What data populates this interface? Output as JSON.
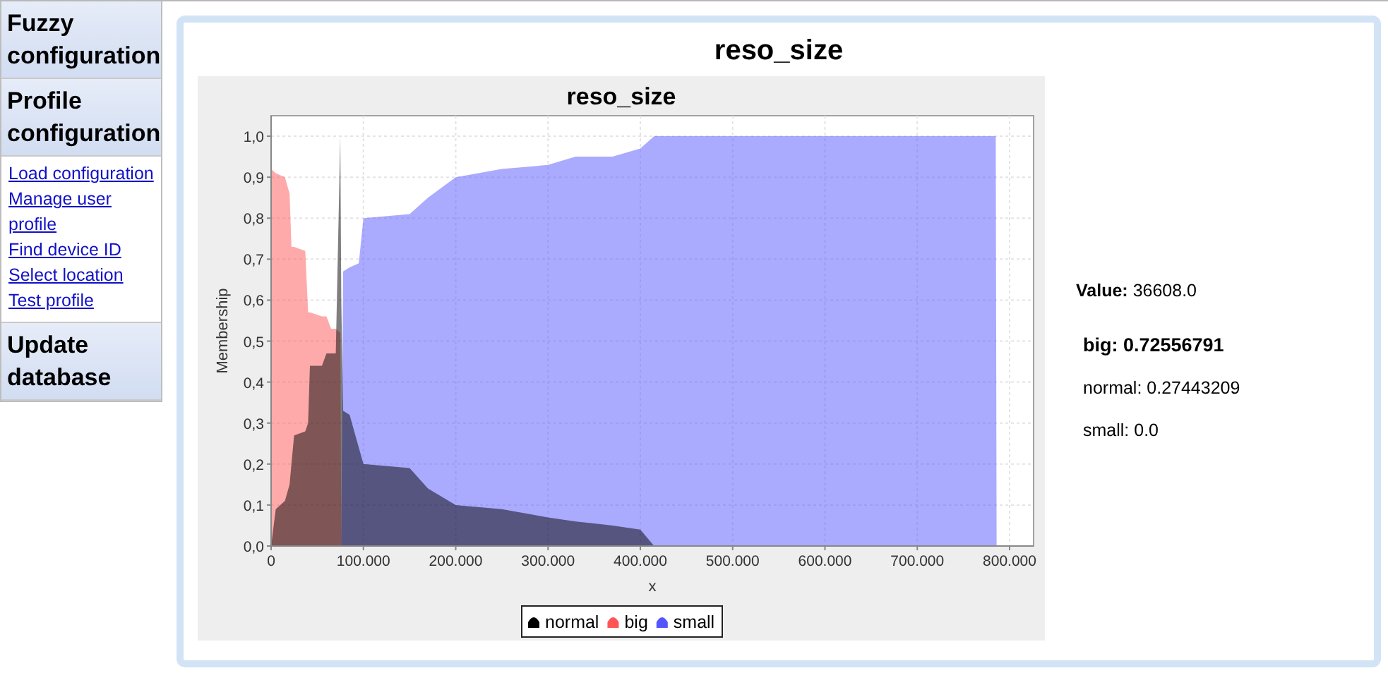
{
  "sidebar": [
    {
      "title": "Fuzzy configuration"
    },
    {
      "title": "Profile configuration",
      "links": [
        "Load configuration",
        "Manage user profile",
        "Find device ID",
        "Select location",
        "Test profile"
      ]
    },
    {
      "title": "Update database"
    }
  ],
  "panel_title": "reso_size",
  "chart_data": {
    "type": "area",
    "title": "reso_size",
    "xlabel": "x",
    "ylabel": "Membership",
    "x": [
      0,
      5000,
      15000,
      20000,
      22000,
      25000,
      37000,
      40000,
      42000,
      55000,
      60000,
      65000,
      70000,
      75000,
      76000,
      78000,
      85000,
      95000,
      100000,
      150000,
      170000,
      200000,
      250000,
      300000,
      330000,
      350000,
      370000,
      400000,
      415000,
      785000,
      786000
    ],
    "series": [
      {
        "name": "normal",
        "color": "#000000",
        "values": [
          0,
          0.09,
          0.11,
          0.15,
          0.2,
          0.27,
          0.28,
          0.3,
          0.44,
          0.44,
          0.47,
          0.47,
          0.47,
          1.0,
          0.6,
          0.33,
          0.32,
          0.24,
          0.2,
          0.19,
          0.14,
          0.1,
          0.09,
          0.07,
          0.06,
          0.055,
          0.05,
          0.04,
          0,
          null,
          null
        ]
      },
      {
        "name": "big",
        "color": "#ff5555",
        "values": [
          0.92,
          0.91,
          0.9,
          0.86,
          0.73,
          0.73,
          0.72,
          0.57,
          0.57,
          0.56,
          0.56,
          0.53,
          0.53,
          0.52,
          0,
          null,
          null,
          null,
          null,
          null,
          null,
          null,
          null,
          null,
          null,
          null,
          null,
          null,
          null,
          null,
          null
        ]
      },
      {
        "name": "small",
        "color": "#5555ff",
        "values": [
          null,
          null,
          null,
          null,
          null,
          null,
          null,
          null,
          null,
          null,
          null,
          null,
          null,
          null,
          0,
          0.67,
          0.68,
          0.69,
          0.8,
          0.81,
          0.85,
          0.9,
          0.92,
          0.93,
          0.95,
          0.95,
          0.95,
          0.97,
          1.0,
          1.0,
          0
        ]
      }
    ],
    "xlim": [
      0,
      826000
    ],
    "ylim": [
      0,
      1.05
    ],
    "grid": true,
    "legend": true,
    "xticks": [
      {
        "value": 0,
        "label": "0"
      },
      {
        "value": 100000,
        "label": "100.000"
      },
      {
        "value": 200000,
        "label": "200.000"
      },
      {
        "value": 300000,
        "label": "300.000"
      },
      {
        "value": 400000,
        "label": "400.000"
      },
      {
        "value": 500000,
        "label": "500.000"
      },
      {
        "value": 600000,
        "label": "600.000"
      },
      {
        "value": 700000,
        "label": "700.000"
      },
      {
        "value": 800000,
        "label": "800.000"
      }
    ],
    "yticks": [
      {
        "value": 0,
        "label": "0,0"
      },
      {
        "value": 0.1,
        "label": "0,1"
      },
      {
        "value": 0.2,
        "label": "0,2"
      },
      {
        "value": 0.3,
        "label": "0,3"
      },
      {
        "value": 0.4,
        "label": "0,4"
      },
      {
        "value": 0.5,
        "label": "0,5"
      },
      {
        "value": 0.6,
        "label": "0,6"
      },
      {
        "value": 0.7,
        "label": "0,7"
      },
      {
        "value": 0.8,
        "label": "0,8"
      },
      {
        "value": 0.9,
        "label": "0,9"
      },
      {
        "value": 1.0,
        "label": "1,0"
      }
    ]
  },
  "readout": {
    "value_label": "Value:",
    "value": "36608.0",
    "memberships": [
      {
        "label": "big:",
        "value": "0.72556791",
        "selected": true
      },
      {
        "label": "normal:",
        "value": "0.27443209",
        "selected": false
      },
      {
        "label": "small:",
        "value": "0.0",
        "selected": false
      }
    ]
  }
}
